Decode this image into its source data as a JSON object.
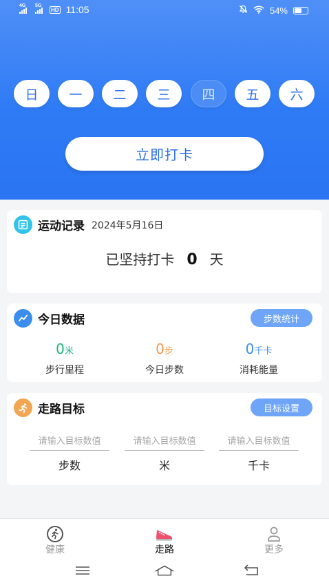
{
  "status_bar": {
    "net1": "4G",
    "net2": "5G",
    "hd": "HD",
    "time": "11:05",
    "battery_text": "54%",
    "battery_level": 0.54,
    "icons": [
      "mute-icon",
      "wifi-icon",
      "battery-icon"
    ]
  },
  "week": {
    "days": [
      "日",
      "一",
      "二",
      "三",
      "四",
      "五",
      "六"
    ],
    "selected_index": 4
  },
  "checkin": {
    "label": "立即打卡"
  },
  "exercise_record": {
    "title": "运动记录",
    "date": "2024年5月16日",
    "streak_prefix": "已坚持打卡",
    "streak_value": "0",
    "streak_suffix": "天"
  },
  "today_data": {
    "title": "今日数据",
    "button": "步数统计",
    "stats": [
      {
        "value": "0",
        "unit": "米",
        "label": "步行里程",
        "color": "#1fb57a"
      },
      {
        "value": "0",
        "unit": "步",
        "label": "今日步数",
        "color": "#f2994a"
      },
      {
        "value": "0",
        "unit": "千卡",
        "label": "消耗能量",
        "color": "#3b8ef0"
      }
    ]
  },
  "walk_goal": {
    "title": "走路目标",
    "button": "目标设置",
    "fields": [
      {
        "placeholder": "请输入目标数值",
        "value": "",
        "unit": "步数"
      },
      {
        "placeholder": "请输入目标数值",
        "value": "",
        "unit": "米"
      },
      {
        "placeholder": "请输入目标数值",
        "value": "",
        "unit": "千卡"
      }
    ]
  },
  "tabbar": {
    "tabs": [
      {
        "label": "健康",
        "icon": "running-man-icon"
      },
      {
        "label": "走路",
        "icon": "shoe-icon",
        "active": true
      },
      {
        "label": "更多",
        "icon": "person-icon"
      }
    ]
  },
  "nav": {
    "icons": [
      "menu-icon",
      "home-icon",
      "back-icon"
    ]
  },
  "colors": {
    "primary": "#2f7bf5",
    "pill": "#6ea5f6",
    "green": "#1fb57a",
    "orange": "#f2994a",
    "blue": "#3b8ef0",
    "accent_red": "#f0506e"
  }
}
